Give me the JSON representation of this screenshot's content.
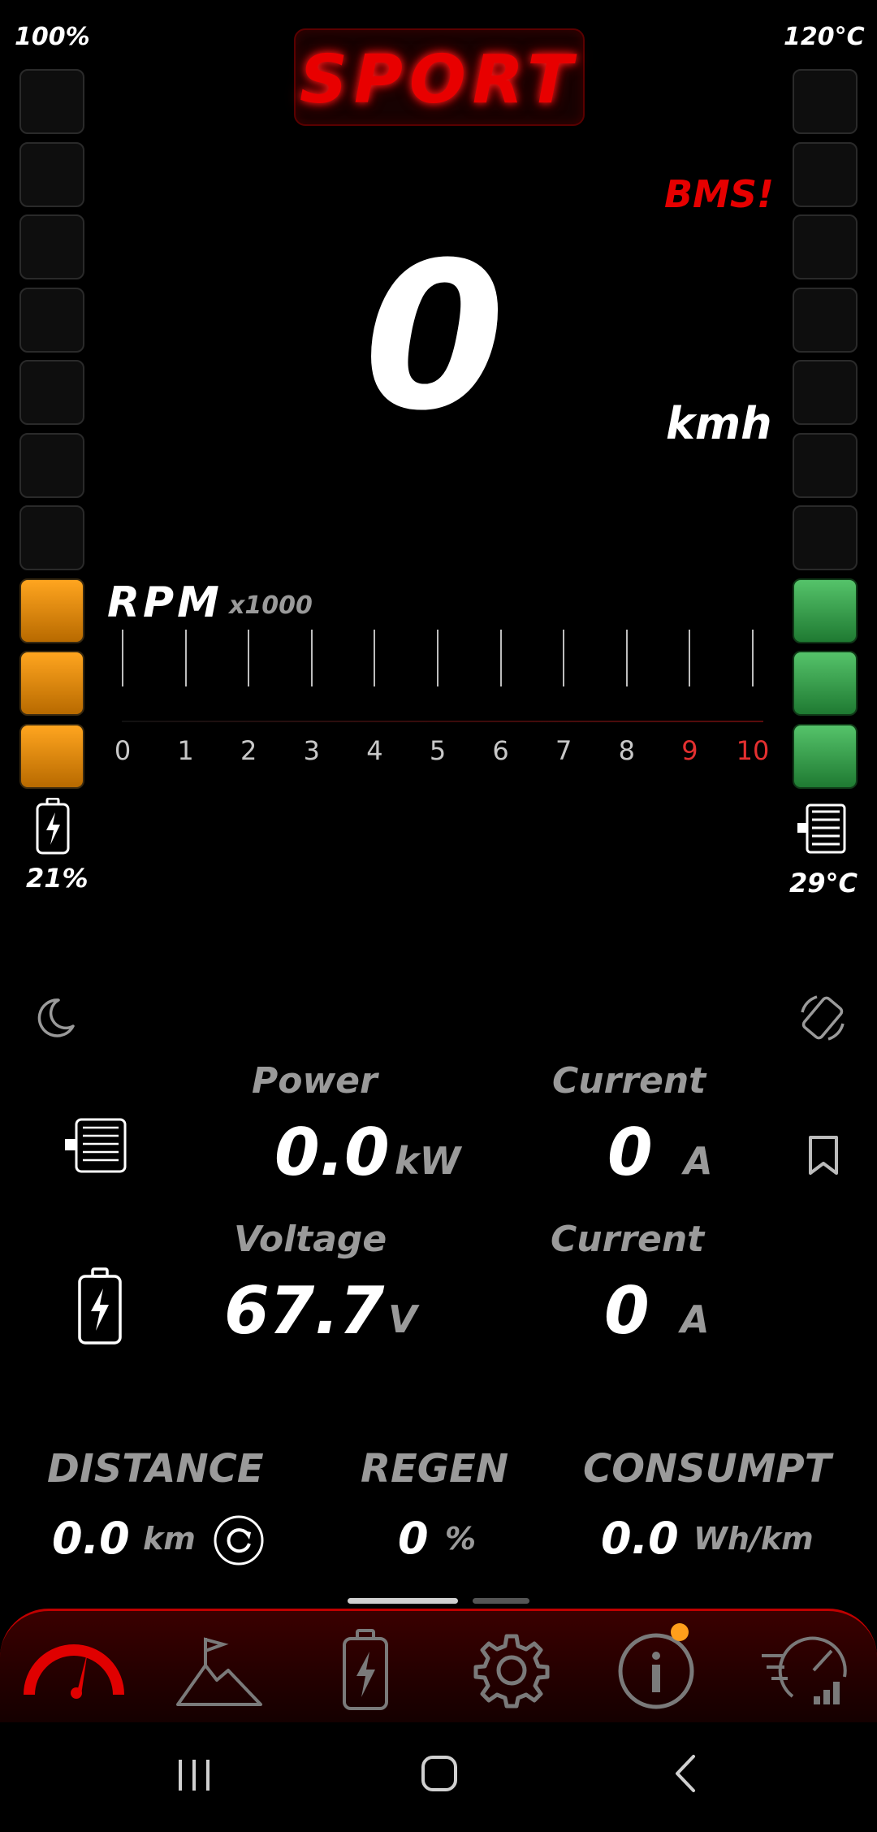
{
  "top": {
    "battery_level": "100%",
    "temp_limit": "120°C",
    "mode": "SPORT",
    "warning": "BMS!"
  },
  "speed": {
    "value": "0",
    "unit": "kmh"
  },
  "battery_bar": {
    "segments": 10,
    "lit": 3,
    "color": "#ffa51f"
  },
  "temp_bar": {
    "segments": 10,
    "lit": 3,
    "color": "#4fbf63"
  },
  "battery": {
    "percent": "21%"
  },
  "motor": {
    "temp": "29°C"
  },
  "rpm": {
    "label": "RPM",
    "multiplier": "x1000",
    "value": 0,
    "scale": [
      "0",
      "1",
      "2",
      "3",
      "4",
      "5",
      "6",
      "7",
      "8",
      "9",
      "10"
    ],
    "red_from": 9
  },
  "motor_stats": {
    "power_label": "Power",
    "power_value": "0.0",
    "power_unit": "kW",
    "current_label": "Current",
    "current_value": "0",
    "current_unit": "A"
  },
  "battery_stats": {
    "voltage_label": "Voltage",
    "voltage_value": "67.7",
    "voltage_unit": "V",
    "current_label": "Current",
    "current_value": "0",
    "current_unit": "A"
  },
  "trip": {
    "distance_label": "DISTANCE",
    "distance_value": "0.0",
    "distance_unit": "km",
    "regen_label": "REGEN",
    "regen_value": "0",
    "regen_unit": "%",
    "consumption_label": "CONSUMPT",
    "consumption_value": "0.0",
    "consumption_unit": "Wh/km"
  },
  "page_indicator": {
    "pages": 2,
    "active": 0
  },
  "bottom_nav": [
    "speedometer-icon",
    "mountain-flag-icon",
    "battery-icon",
    "gear-icon",
    "info-icon",
    "performance-icon"
  ],
  "system_nav": [
    "recents-icon",
    "home-icon",
    "back-icon"
  ],
  "colors": {
    "accent": "#e80000",
    "orange": "#ffa51f",
    "green": "#4fbf63",
    "notification": "#ff9e1b"
  }
}
